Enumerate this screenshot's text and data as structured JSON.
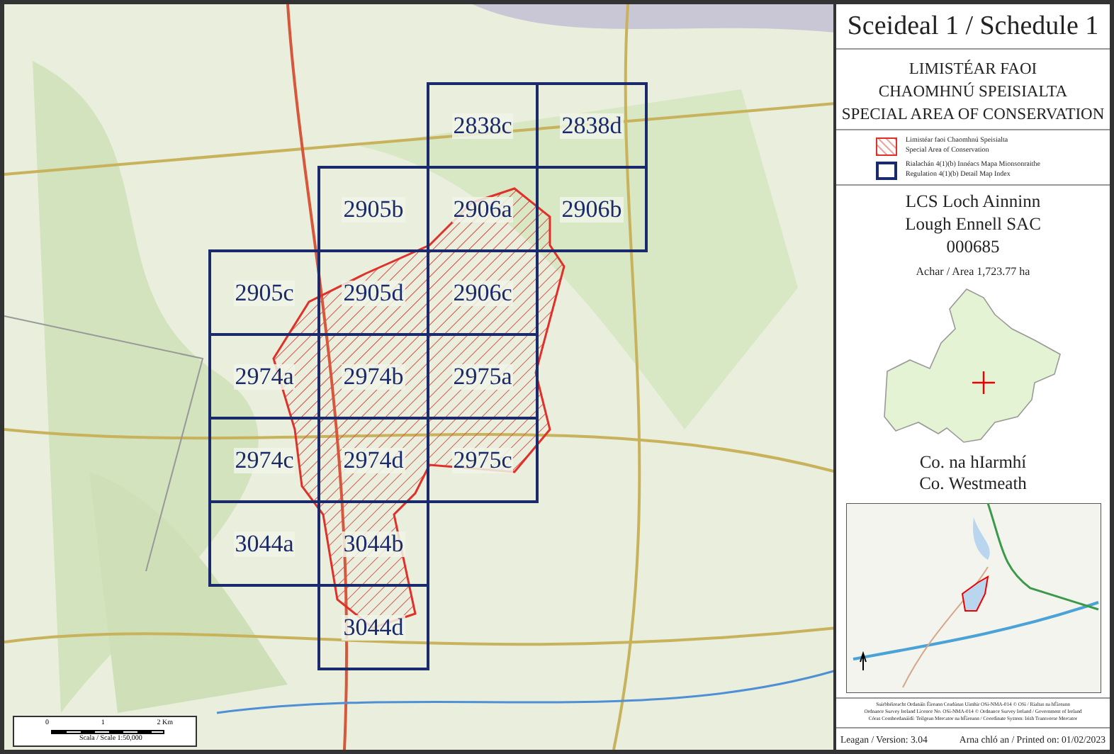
{
  "map": {
    "tiles": [
      "2838c",
      "2838d",
      "2905b",
      "2906a",
      "2906b",
      "2905c",
      "2905d",
      "2906c",
      "2974a",
      "2974b",
      "2975a",
      "2974c",
      "2974d",
      "2975c",
      "3044a",
      "3044b",
      "3044d"
    ],
    "scale_bar": {
      "ticks": [
        "0",
        "1",
        "2 Km"
      ],
      "caption": "Scala / Scale 1:50,000"
    }
  },
  "panel": {
    "title": "Sceideal 1 / Schedule 1",
    "subtitle_lines": [
      "LIMISTÉAR FAOI",
      "CHAOMHNÚ SPEISIALTA",
      "SPECIAL AREA OF CONSERVATION"
    ],
    "legend": [
      {
        "kind": "sac",
        "lines": [
          "Limistéar faoi Chaomhnú Speisialta",
          "Special Area of Conservation"
        ]
      },
      {
        "kind": "index",
        "lines": [
          "Rialachán 4(1)(b) Innéacs Mapa Mionsonraithe",
          "Regulation 4(1)(b) Detail Map Index"
        ]
      }
    ],
    "site_lines": [
      "LCS Loch Ainninn",
      "Lough Ennell SAC",
      "000685"
    ],
    "area": "Achar / Area 1,723.77 ha",
    "county_lines": [
      "Co. na hIarmhí",
      "Co. Westmeath"
    ],
    "copyright_lines": [
      "Suirbhéireacht Ordanáis Éireann Ceadúnas Uimhir OSi-NMA-014 © OSi / Rialtas na hÉireann",
      "Ordnance Survey Ireland Licence No. OSi-NMA-014 © Ordnance Survey Ireland / Government of Ireland",
      "Córas Comhordanáidí: Teilgean Mercator na hÉireann / Coordinate System: Irish Transverse Mercator"
    ],
    "version": "Leagan / Version: 3.04",
    "printed": "Arna chló an / Printed on: 01/02/2023"
  }
}
